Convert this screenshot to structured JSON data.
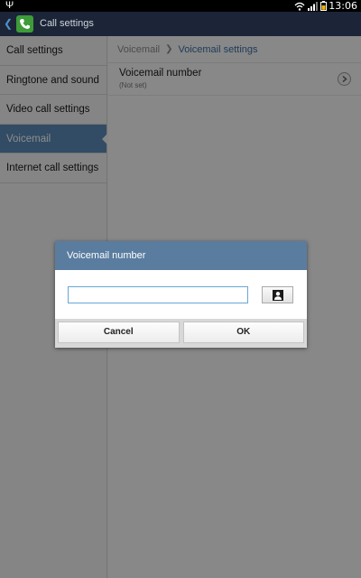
{
  "status_bar": {
    "time": "13:06",
    "icons": [
      "usb-icon",
      "wifi-icon",
      "signal-icon",
      "battery-icon"
    ]
  },
  "action_bar": {
    "title": "Call settings",
    "app_icon": "phone-icon"
  },
  "menu": {
    "items": [
      {
        "label": "Call settings"
      },
      {
        "label": "Ringtone and sound"
      },
      {
        "label": "Video call settings"
      },
      {
        "label": "Voicemail",
        "active": true
      },
      {
        "label": "Internet call settings"
      }
    ]
  },
  "pane": {
    "breadcrumb": {
      "parent": "Voicemail",
      "current": "Voicemail settings"
    },
    "rows": [
      {
        "title": "Voicemail number",
        "subtitle": "(Not set)"
      }
    ]
  },
  "dialog": {
    "title": "Voicemail number",
    "input_value": "",
    "contact_icon": "contact-icon",
    "cancel_label": "Cancel",
    "ok_label": "OK"
  },
  "colors": {
    "action_bar": "#1b2537",
    "menu_active": "#5b8ab8",
    "breadcrumb_current": "#3a6ea5",
    "dialog_header": "#5a7c9f",
    "input_border": "#69a6d4"
  }
}
